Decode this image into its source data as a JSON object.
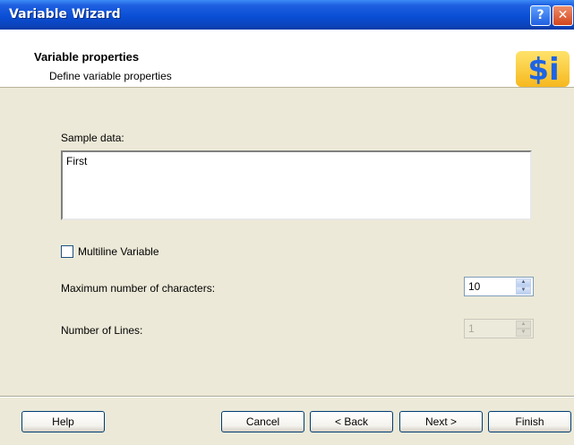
{
  "window": {
    "title": "Variable Wizard",
    "help_glyph": "?",
    "close_glyph": "✕"
  },
  "header": {
    "title": "Variable properties",
    "subtitle": "Define variable properties",
    "logo_text": "$i"
  },
  "form": {
    "sample_label": "Sample data:",
    "sample_value": "First",
    "multiline_label": "Multiline Variable",
    "multiline_checked": false,
    "max_chars_label": "Maximum number of characters:",
    "max_chars_value": "10",
    "num_lines_label": "Number of Lines:",
    "num_lines_value": "1",
    "spin_up": "▲",
    "spin_down": "▼"
  },
  "buttons": {
    "help": "Help",
    "cancel": "Cancel",
    "back": "< Back",
    "next": "Next >",
    "finish": "Finish"
  },
  "colors": {
    "title_bar": "#0a4fd6",
    "dialog_bg": "#ece9d8",
    "header_bg": "#ffffff",
    "button_border": "#003c74"
  }
}
